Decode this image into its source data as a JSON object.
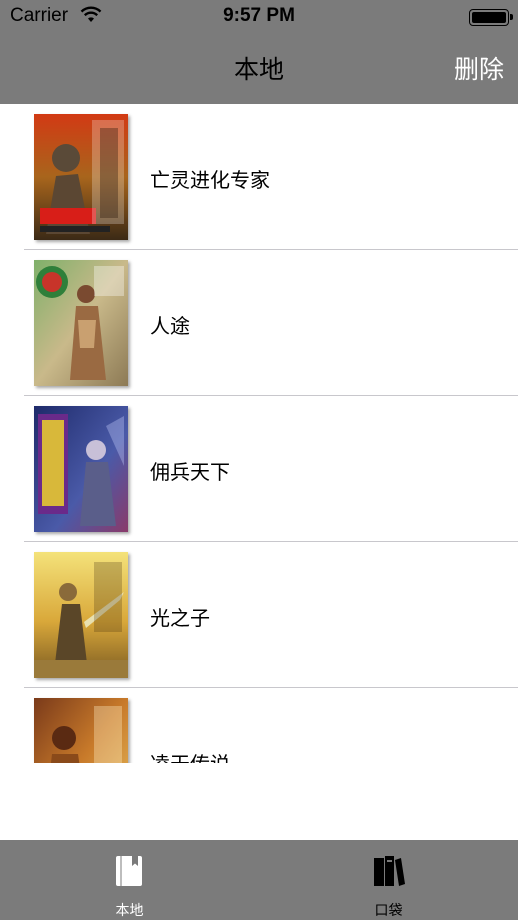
{
  "status_bar": {
    "carrier": "Carrier",
    "time": "9:57 PM",
    "wifi_icon": "wifi-icon",
    "battery_icon": "battery-full-icon"
  },
  "nav": {
    "title": "本地",
    "right_button": "删除"
  },
  "books": [
    {
      "title": "亡灵进化专家",
      "cover_icon": "book-cover-image"
    },
    {
      "title": "人途",
      "cover_icon": "book-cover-image"
    },
    {
      "title": "佣兵天下",
      "cover_icon": "book-cover-image"
    },
    {
      "title": "光之子",
      "cover_icon": "book-cover-image"
    },
    {
      "title": "凌天传说",
      "cover_icon": "book-cover-image"
    }
  ],
  "tabbar": {
    "tabs": [
      {
        "label": "本地",
        "icon": "book-icon",
        "active": true
      },
      {
        "label": "口袋",
        "icon": "bookshelf-icon",
        "active": false
      }
    ]
  },
  "colors": {
    "bar_background": "#7b7b7b",
    "active_tab": "#ffffff",
    "divider": "#c8c7cc"
  }
}
